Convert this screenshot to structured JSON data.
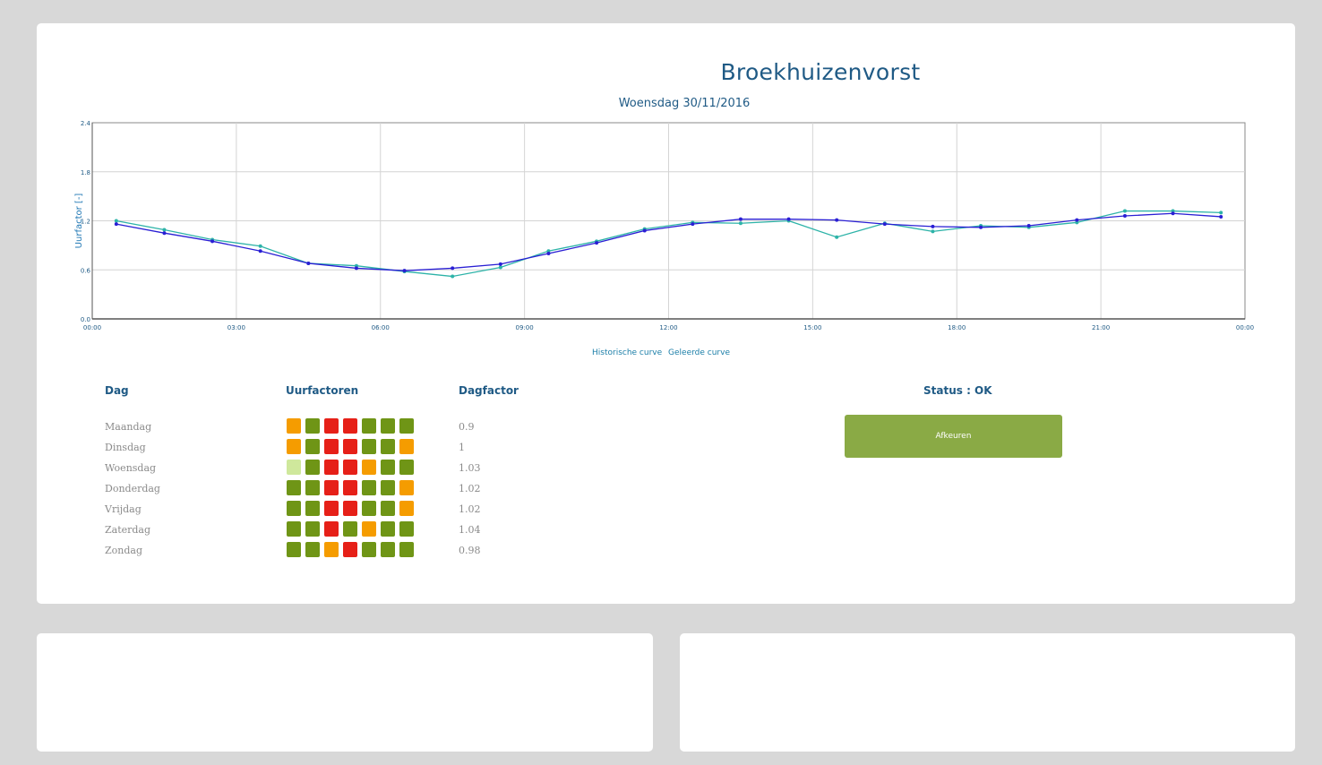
{
  "header": {
    "title": "Broekhuizenvorst",
    "subtitle": "Woensdag 30/11/2016"
  },
  "chart_data": {
    "type": "line",
    "ylabel": "Uurfactor [-]",
    "xlabel": "",
    "ylim": [
      0,
      2.4
    ],
    "xlim": [
      0,
      24
    ],
    "y_ticks": [
      "0.0",
      "0.6",
      "1.2",
      "1.8",
      "2.4"
    ],
    "x_ticks": [
      "00:00",
      "03:00",
      "06:00",
      "09:00",
      "12:00",
      "15:00",
      "18:00",
      "21:00",
      "00:00"
    ],
    "grid": true,
    "legend_position": "bottom",
    "series": [
      {
        "name": "Historische curve",
        "color": "#2db3a8",
        "x": [
          0.5,
          1.5,
          2.5,
          3.5,
          4.5,
          5.5,
          6.5,
          7.5,
          8.5,
          9.5,
          10.5,
          11.5,
          12.5,
          13.5,
          14.5,
          15.5,
          16.5,
          17.5,
          18.5,
          19.5,
          20.5,
          21.5,
          22.5,
          23.5
        ],
        "values": [
          1.2,
          1.09,
          0.97,
          0.89,
          0.68,
          0.65,
          0.58,
          0.52,
          0.63,
          0.83,
          0.95,
          1.1,
          1.18,
          1.17,
          1.2,
          1.0,
          1.17,
          1.07,
          1.14,
          1.12,
          1.18,
          1.32,
          1.32,
          1.3
        ]
      },
      {
        "name": "Geleerde curve",
        "color": "#2a1fd4",
        "x": [
          0.5,
          1.5,
          2.5,
          3.5,
          4.5,
          5.5,
          6.5,
          7.5,
          8.5,
          9.5,
          10.5,
          11.5,
          12.5,
          13.5,
          14.5,
          15.5,
          16.5,
          17.5,
          18.5,
          19.5,
          20.5,
          21.5,
          22.5,
          23.5
        ],
        "values": [
          1.16,
          1.05,
          0.95,
          0.83,
          0.68,
          0.62,
          0.59,
          0.62,
          0.67,
          0.8,
          0.93,
          1.08,
          1.16,
          1.22,
          1.22,
          1.21,
          1.16,
          1.13,
          1.12,
          1.14,
          1.21,
          1.26,
          1.29,
          1.25
        ]
      }
    ]
  },
  "legend": {
    "historic": "Historische curve",
    "learned": "Geleerde curve"
  },
  "table": {
    "headers": {
      "day": "Dag",
      "hour_factors": "Uurfactoren",
      "day_factor": "Dagfactor"
    },
    "colors": {
      "g": "#6f9516",
      "r": "#e62018",
      "o": "#f59c00",
      "l": "#cfe89c"
    },
    "rows": [
      {
        "day": "Maandag",
        "factor": "0.9",
        "squares": [
          "o",
          "g",
          "r",
          "r",
          "g",
          "g",
          "g"
        ]
      },
      {
        "day": "Dinsdag",
        "factor": "1",
        "squares": [
          "o",
          "g",
          "r",
          "r",
          "g",
          "g",
          "o"
        ]
      },
      {
        "day": "Woensdag",
        "factor": "1.03",
        "squares": [
          "l",
          "g",
          "r",
          "r",
          "o",
          "g",
          "g"
        ]
      },
      {
        "day": "Donderdag",
        "factor": "1.02",
        "squares": [
          "g",
          "g",
          "r",
          "r",
          "g",
          "g",
          "o"
        ]
      },
      {
        "day": "Vrijdag",
        "factor": "1.02",
        "squares": [
          "g",
          "g",
          "r",
          "r",
          "g",
          "g",
          "o"
        ]
      },
      {
        "day": "Zaterdag",
        "factor": "1.04",
        "squares": [
          "g",
          "g",
          "r",
          "g",
          "o",
          "g",
          "g"
        ]
      },
      {
        "day": "Zondag",
        "factor": "0.98",
        "squares": [
          "g",
          "g",
          "o",
          "r",
          "g",
          "g",
          "g"
        ]
      }
    ]
  },
  "status": {
    "label": "Status : OK",
    "reject_button": "Afkeuren"
  }
}
